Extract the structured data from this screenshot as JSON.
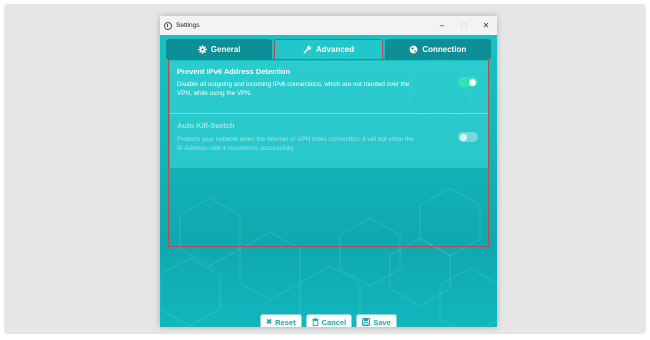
{
  "window": {
    "title": "Settings"
  },
  "controls": {
    "minimize": "–",
    "maximize": "□",
    "close": "✕"
  },
  "tabs": [
    {
      "label": "General",
      "icon": "gear-icon",
      "active": false
    },
    {
      "label": "Advanced",
      "icon": "wrench-icon",
      "active": true
    },
    {
      "label": "Connection",
      "icon": "globe-icon",
      "active": false
    }
  ],
  "settings": [
    {
      "title": "Prevent IPv6 Address Detection",
      "description": "Disable all outgoing and incoming IPv6 connections, which are not rounted over the VPN, while using the VPN.",
      "enabled": true
    },
    {
      "title": "Auto Kill-Switch",
      "description": "Protects your network when the Internet or VPN loses connection, it will not show the IP Address until it reconnects successfully.",
      "enabled": false
    }
  ],
  "buttons": {
    "reset": "Reset",
    "cancel": "Cancel",
    "save": "Save"
  },
  "colors": {
    "accent": "#17c1c4",
    "toggle_on": "#2ee6b5",
    "active_tab_border": "#b84a52"
  }
}
